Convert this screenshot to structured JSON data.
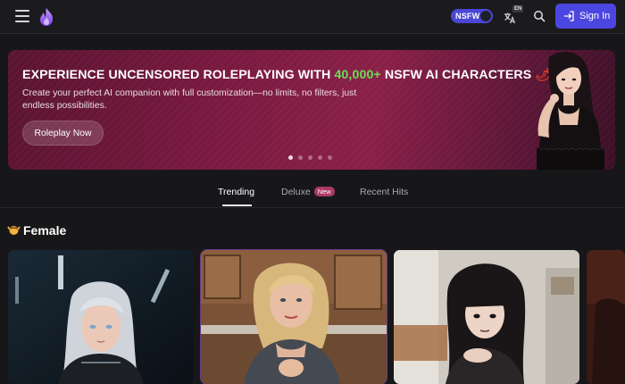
{
  "header": {
    "nsfw_label": "NSFW",
    "lang_tag": "EN",
    "signin_label": "Sign In"
  },
  "hero": {
    "title_pre": "EXPERIENCE UNCENSORED ROLEPLAYING WITH ",
    "title_highlight": "40,000+",
    "title_post": " NSFW AI CHARACTERS",
    "title_emoji": "🌶",
    "description": "Create your perfect AI companion with full customization—no limits, no filters, just endless possibilities.",
    "cta_label": "Roleplay Now",
    "slide_count": 5,
    "active_slide": 1
  },
  "tabs": [
    {
      "label": "Trending",
      "active": true
    },
    {
      "label": "Deluxe",
      "badge": "New",
      "active": false
    },
    {
      "label": "Recent Hits",
      "active": false
    }
  ],
  "section": {
    "title": "Female",
    "emoji": "🙆"
  },
  "colors": {
    "accent": "#4c46e0",
    "highlight_green": "#6bdc58",
    "background": "#17171a",
    "new_badge": "#a93a62"
  }
}
